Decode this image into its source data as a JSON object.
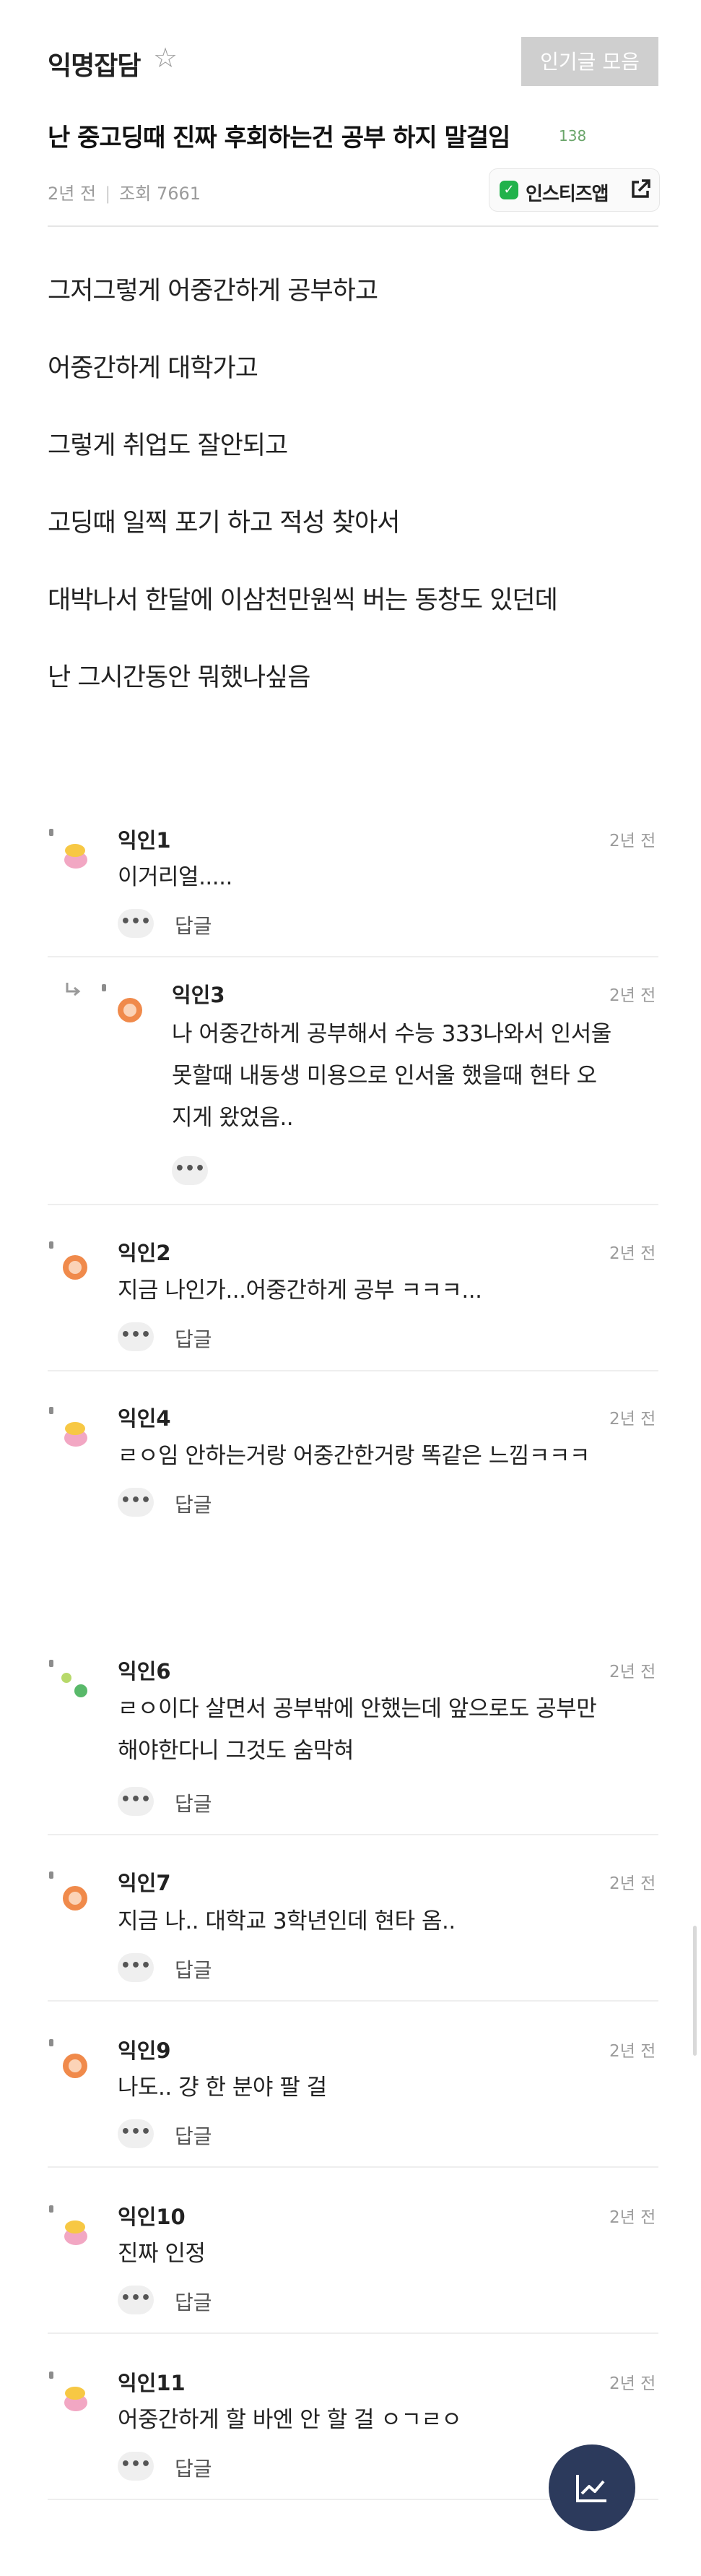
{
  "header": {
    "board_name": "익명잡담",
    "popular_button": "인기글 모음"
  },
  "post": {
    "title": "난 중고딩때 진짜 후회하는건 공부 하지 말걸임",
    "comment_count": "138",
    "time": "2년 전",
    "views": "조회 7661",
    "app_button": "인스티즈앱",
    "body": [
      "그저그렇게 어중간하게 공부하고",
      "어중간하게 대학가고",
      "그렇게 취업도 잘안되고",
      "고딩때 일찍 포기 하고 적성 찾아서",
      "대박나서 한달에 이삼천만원씩 버는 동창도 있던데",
      "난 그시간동안 뭐했나싶음"
    ]
  },
  "comments": [
    {
      "author": "익인1",
      "time": "2년 전",
      "lines": [
        "이거리얼....."
      ],
      "reply_label": "답글"
    },
    {
      "author": "익인3",
      "time": "2년 전",
      "lines": [
        "나 어중간하게 공부해서 수능 333나와서 인서울",
        "못할때 내동생 미용으로 인서울 했을때 현타 오",
        "지게 왔었음.."
      ]
    },
    {
      "author": "익인2",
      "time": "2년 전",
      "lines": [
        "지금 나인가...어중간하게 공부 ㅋㅋㅋ..."
      ],
      "reply_label": "답글"
    },
    {
      "author": "익인4",
      "time": "2년 전",
      "lines": [
        "ㄹㅇ임 안하는거랑 어중간한거랑 똑같은 느낌ㅋㅋㅋ"
      ],
      "reply_label": "답글"
    },
    {
      "author": "익인6",
      "time": "2년 전",
      "lines": [
        "ㄹㅇ이다 살면서 공부밖에 안했는데 앞으로도 공부만",
        "해야한다니 그것도 숨막혀"
      ],
      "reply_label": "답글"
    },
    {
      "author": "익인7",
      "time": "2년 전",
      "lines": [
        "지금 나.. 대학교 3학년인데 현타 옴.."
      ],
      "reply_label": "답글"
    },
    {
      "author": "익인9",
      "time": "2년 전",
      "lines": [
        "나도.. 걍 한 분야 팔 걸"
      ],
      "reply_label": "답글"
    },
    {
      "author": "익인10",
      "time": "2년 전",
      "lines": [
        "진짜 인정"
      ],
      "reply_label": "답글"
    },
    {
      "author": "익인11",
      "time": "2년 전",
      "lines": [
        "어중간하게 할 바엔 안 할 걸 ㅇㄱㄹㅇ"
      ],
      "reply_label": "답글"
    }
  ],
  "colors": {
    "accent_green": "#21b24b",
    "fab_navy": "#2c3a5c",
    "avatar_orange": "#f08a4b",
    "avatar_pink": "#f2a7c3",
    "avatar_yellow": "#f7c844",
    "avatar_green": "#59b96a"
  },
  "icons": {
    "favorite": "star-outline-icon",
    "external": "external-link-icon",
    "more": "ellipsis-icon",
    "reply": "reply-arrow-icon",
    "fab": "chart-trend-icon"
  }
}
